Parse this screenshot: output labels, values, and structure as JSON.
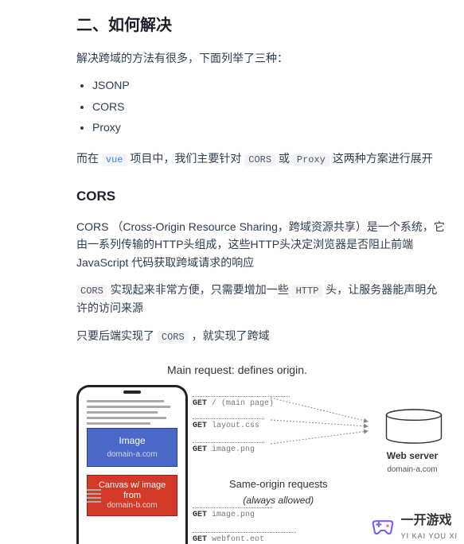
{
  "heading": "二、如何解决",
  "intro": "解决跨域的方法有很多，下面列举了三种：",
  "methods": [
    "JSONP",
    "CORS",
    "Proxy"
  ],
  "para_vue_prefix": "而在 ",
  "kw_vue": "vue",
  "para_vue_mid": " 项目中，我们主要针对 ",
  "kw_cors": "CORS",
  "para_vue_mid2": " 或 ",
  "kw_proxy": "Proxy",
  "para_vue_suffix": " 这两种方案进行展开",
  "cors_title": "CORS",
  "cors_p1": "CORS （Cross-Origin Resource Sharing，跨域资源共享）是一个系统，它由一系列传输的HTTP头组成，这些HTTP头决定浏览器是否阻止前端 JavaScript 代码获取跨域请求的响应",
  "cors_p2_code1": "CORS",
  "cors_p2_a": " 实现起来非常方便，只需要增加一些 ",
  "cors_p2_code2": "HTTP",
  "cors_p2_b": " 头，让服务器能声明允许的访问来源",
  "cors_p3_a": "只要后端实现了 ",
  "cors_p3_code": "CORS",
  "cors_p3_b": " ，就实现了跨域",
  "diagram": {
    "main_req": "Main request: defines origin.",
    "image_box": "Image",
    "image_box_sub": "domain-a.com",
    "canvas_box": "Canvas w/ image from",
    "canvas_box_sub": "domain-b.com",
    "server": "Web server",
    "server_sub": "domain-a.com",
    "same_origin": "Same-origin requests",
    "same_origin_sub": "(always allowed)",
    "req1_method": "GET",
    "req1_path": "/   (main page)",
    "req2_method": "GET",
    "req2_path": "layout.css",
    "req3_method": "GET",
    "req3_path": "image.png",
    "req4_method": "GET",
    "req4_path": "image.png",
    "req5_method": "GET",
    "req5_path": "webfont.eot"
  },
  "logo": {
    "name": "一开游戏",
    "pinyin": "YI KAI YOU XI"
  }
}
